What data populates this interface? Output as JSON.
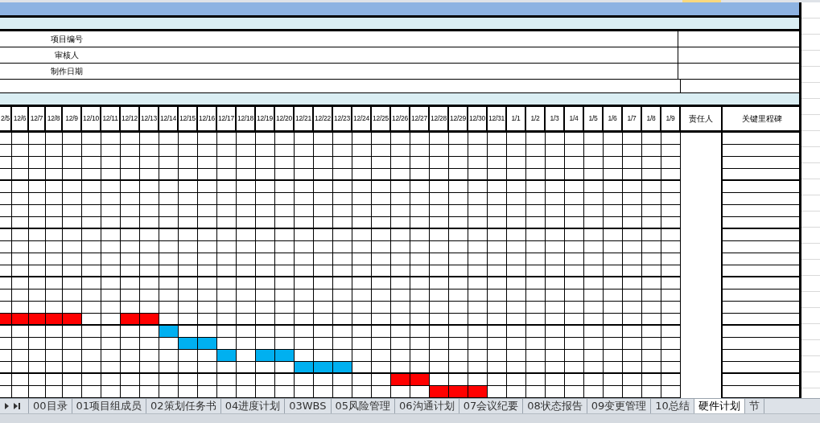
{
  "sheet": {
    "info_rows": [
      {
        "label": "项目编号"
      },
      {
        "label": "审核人"
      },
      {
        "label": "制作日期"
      }
    ],
    "dates": [
      "2/5",
      "12/6",
      "12/7",
      "12/8",
      "12/9",
      "12/10",
      "12/11",
      "12/12",
      "12/13",
      "12/14",
      "12/15",
      "12/16",
      "12/17",
      "12/18",
      "12/19",
      "12/20",
      "12/21",
      "12/22",
      "12/23",
      "12/24",
      "12/25",
      "12/26",
      "12/27",
      "12/28",
      "12/29",
      "12/30",
      "12/31",
      "1/1",
      "1/2",
      "1/3",
      "1/4",
      "1/5",
      "1/6",
      "1/7",
      "1/8",
      "1/9"
    ],
    "side_columns": [
      "责任人",
      "关键里程碑"
    ],
    "rows": [
      {},
      {},
      {},
      {},
      {},
      {},
      {},
      {},
      {},
      {},
      {},
      {},
      {},
      {},
      {},
      {
        "cells": [
          {
            "color": "#ff0000"
          },
          {
            "color": "#ff0000"
          },
          {
            "color": "#ff0000"
          },
          {
            "color": "#ff0000"
          },
          {
            "color": "#ff0000"
          },
          null,
          null,
          {
            "color": "#ff0000"
          },
          {
            "color": "#ff0000"
          }
        ]
      },
      {
        "cells": [
          null,
          null,
          null,
          null,
          null,
          null,
          null,
          null,
          null,
          {
            "color": "#00b0f0"
          }
        ]
      },
      {
        "cells": [
          null,
          null,
          null,
          null,
          null,
          null,
          null,
          null,
          null,
          null,
          {
            "color": "#00b0f0"
          },
          {
            "color": "#00b0f0"
          }
        ]
      },
      {
        "cells": [
          null,
          null,
          null,
          null,
          null,
          null,
          null,
          null,
          null,
          null,
          null,
          null,
          {
            "color": "#00b0f0"
          },
          null,
          {
            "color": "#00b0f0"
          },
          {
            "color": "#00b0f0"
          }
        ]
      },
      {
        "cells": [
          null,
          null,
          null,
          null,
          null,
          null,
          null,
          null,
          null,
          null,
          null,
          null,
          null,
          null,
          null,
          null,
          {
            "color": "#00b0f0"
          },
          {
            "color": "#00b0f0"
          },
          {
            "color": "#00b0f0"
          }
        ]
      },
      {
        "cells": [
          null,
          null,
          null,
          null,
          null,
          null,
          null,
          null,
          null,
          null,
          null,
          null,
          null,
          null,
          null,
          null,
          null,
          null,
          null,
          null,
          null,
          {
            "color": "#ff0000"
          },
          {
            "color": "#ff0000"
          }
        ]
      },
      {
        "cells": [
          null,
          null,
          null,
          null,
          null,
          null,
          null,
          null,
          null,
          null,
          null,
          null,
          null,
          null,
          null,
          null,
          null,
          null,
          null,
          null,
          null,
          null,
          null,
          {
            "color": "#ff0000"
          },
          {
            "color": "#ff0000"
          },
          {
            "color": "#ff0000"
          }
        ]
      }
    ]
  },
  "tabs": [
    {
      "label": "00目录",
      "selected": false
    },
    {
      "label": "01项目组成员",
      "selected": false
    },
    {
      "label": "02策划任务书",
      "selected": false
    },
    {
      "label": "04进度计划",
      "selected": false
    },
    {
      "label": "03WBS",
      "selected": false
    },
    {
      "label": "05风险管理",
      "selected": false
    },
    {
      "label": "06沟通计划",
      "selected": false
    },
    {
      "label": "07会议纪要",
      "selected": false
    },
    {
      "label": "08状态报告",
      "selected": false
    },
    {
      "label": "09变更管理",
      "selected": false
    },
    {
      "label": "10总结",
      "selected": false
    },
    {
      "label": "硬件计划",
      "selected": true
    },
    {
      "label": "节",
      "selected": false
    }
  ]
}
